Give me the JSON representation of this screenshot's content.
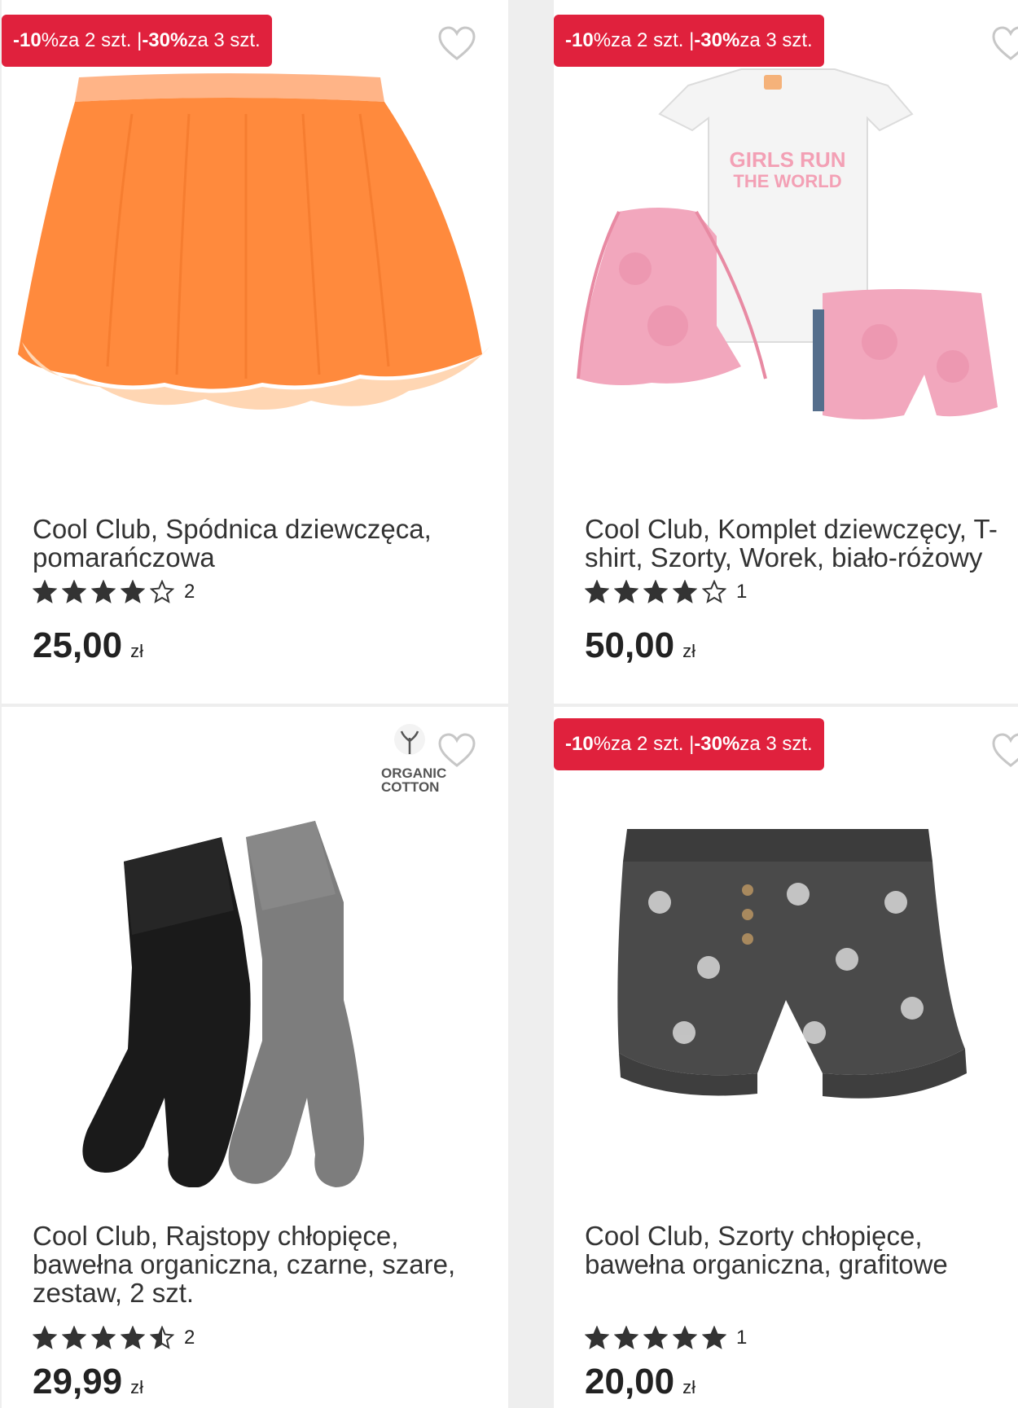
{
  "products": [
    {
      "promo": {
        "part1_bold": "-10",
        "part1_pct": "%",
        "part1_rest": " za 2 szt. | ",
        "part2_bold": "-30%",
        "part2_rest": " za 3 szt."
      },
      "name": "Cool Club, Spódnica dziewczęca, pomarańczowa",
      "rating_count": "2",
      "rating_value": 4,
      "price": "25,00",
      "currency": "zł",
      "icon": "orange-tulle-skirt"
    },
    {
      "promo": {
        "part1_bold": "-10",
        "part1_pct": "%",
        "part1_rest": " za 2 szt. | ",
        "part2_bold": "-30%",
        "part2_rest": " za 3 szt."
      },
      "name": "Cool Club, Komplet dziewczęcy, T-shirt, Szorty, Worek, biało-różowy",
      "rating_count": "1",
      "rating_value": 4,
      "price": "50,00",
      "currency": "zł",
      "icon": "girls-set-tshirt-shorts-bag",
      "tshirt_text_1": "GIRLS RUN",
      "tshirt_text_2": "THE WORLD"
    },
    {
      "badge": {
        "line1": "ORGANIC",
        "line2": "COTTON"
      },
      "name": "Cool Club, Rajstopy chłopięce, bawełna organiczna, czarne, szare, zestaw, 2 szt.",
      "rating_count": "2",
      "rating_value": 4.5,
      "price": "29,99",
      "currency": "zł",
      "icon": "tights-black-grey"
    },
    {
      "promo": {
        "part1_bold": "-10",
        "part1_pct": "%",
        "part1_rest": " za 2 szt. | ",
        "part2_bold": "-30%",
        "part2_rest": " za 3 szt."
      },
      "name": "Cool Club, Szorty chłopięce, bawełna organiczna, grafitowe",
      "rating_count": "1",
      "rating_value": 5,
      "price": "20,00",
      "currency": "zł",
      "icon": "graphite-palm-shorts"
    }
  ],
  "colors": {
    "promo_bg": "#e0213d",
    "star": "#333333",
    "skirt": "#ff8a3d",
    "pink": "#f2a7bd",
    "graphite": "#4a4a4a"
  }
}
